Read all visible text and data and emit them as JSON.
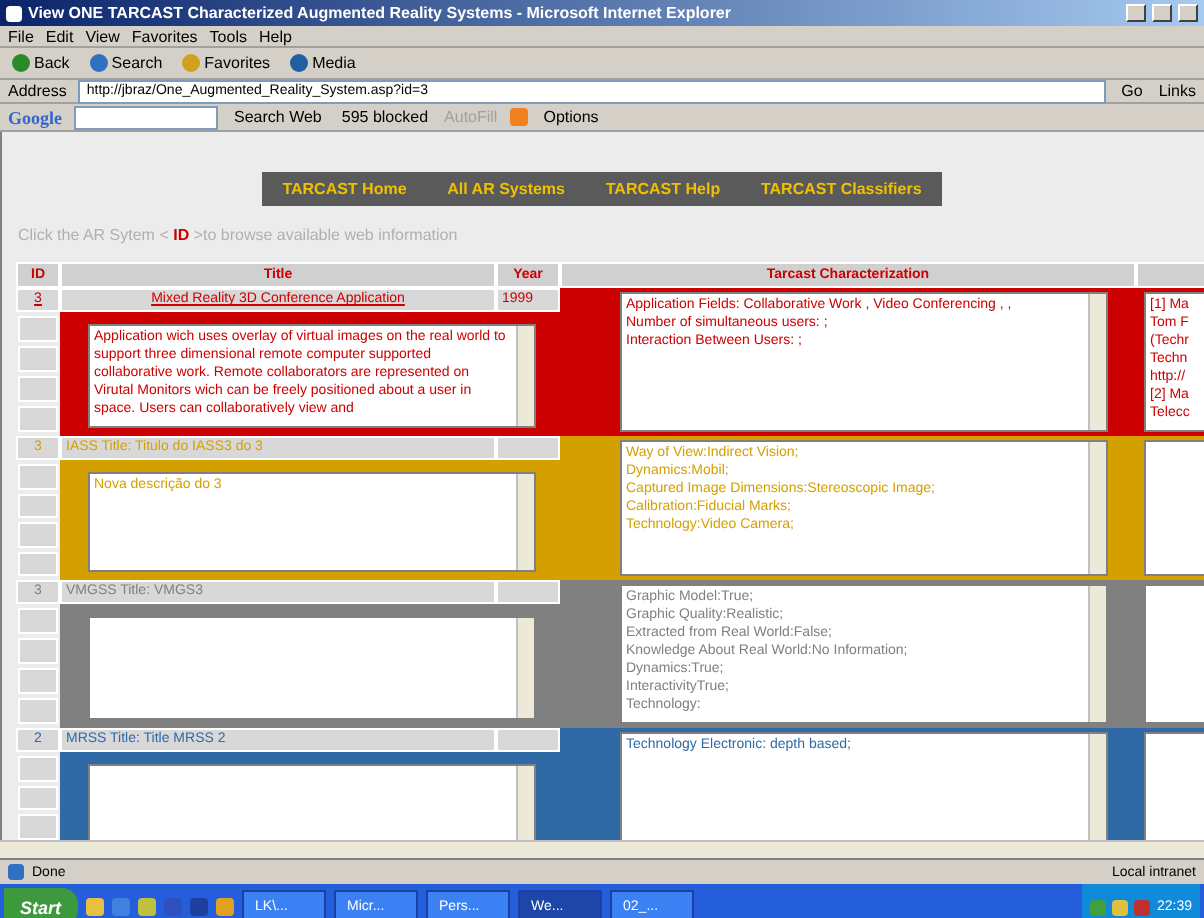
{
  "window": {
    "title": "View ONE TARCAST Characterized Augmented Reality Systems - Microsoft Internet Explorer"
  },
  "menu": [
    "File",
    "Edit",
    "View",
    "Favorites",
    "Tools",
    "Help"
  ],
  "toolbar": [
    "Back",
    "Search",
    "Favorites",
    "Media"
  ],
  "address": {
    "label": "Address",
    "value": "http://jbraz/One_Augmented_Reality_System.asp?id=3",
    "go": "Go",
    "links": "Links"
  },
  "google_bar": {
    "logo": "Google",
    "search": "Search Web",
    "blocked": "595 blocked",
    "autofill": "AutoFill",
    "options": "Options"
  },
  "nav": [
    "TARCAST Home",
    "All AR Systems",
    "TARCAST Help",
    "TARCAST Classifiers"
  ],
  "instruction": "Click the AR Sytem < **ID** >to browse available web information",
  "table": {
    "columns": [
      "ID",
      "Title",
      "Year",
      "Tarcast Characterization"
    ],
    "rows": [
      {
        "id": "3",
        "title": "Mixed Reality 3D Conference Application",
        "linked": true,
        "year": "1999",
        "color": "#cc0000",
        "description": "Application wich uses overlay of virtual images on the real world to support three dimensional remote computer supported collaborative work. Remote collaborators are represented on Virutal Monitors wich can be freely positioned about a user in space. Users can collaboratively view and",
        "characterization": [
          "Application Fields: Collaborative Work , Video Conferencing , ,",
          "Number of simultaneous users: ;",
          "Interaction Between Users: ;"
        ],
        "references": [
          "[1] Ma",
          "Tom F",
          "(Techr",
          "Techn",
          "http://",
          "[2] Ma",
          "Telecc"
        ]
      },
      {
        "id": "3",
        "title": "IASS Title: Titulo do IASS3 do 3",
        "linked": false,
        "color": "#d4a000",
        "description": "Nova descrição do 3",
        "characterization": [
          "Way of View:Indirect Vision;",
          "Dynamics:Mobil;",
          "Captured Image Dimensions:Stereoscopic Image;",
          "Calibration:Fiducial Marks;",
          "Technology:Video Camera;"
        ]
      },
      {
        "id": "3",
        "title": "VMGSS Title: VMGS3",
        "linked": false,
        "color": "#808080",
        "characterization": [
          "Graphic Model:True;",
          "Graphic Quality:Realistic;",
          "Extracted from Real World:False;",
          "Knowledge About Real World:No Information;",
          "Dynamics:True;",
          "InteractivityTrue;",
          "Technology:"
        ]
      },
      {
        "id": "2",
        "title": "MRSS Title: Title MRSS 2",
        "linked": false,
        "color": "#2f6aa6",
        "characterization": [
          "Technology Electronic: depth based;"
        ]
      }
    ]
  },
  "status_bar": {
    "text": "Done",
    "zone": "Local intranet"
  },
  "taskbar": {
    "start": "Start",
    "tasks": [
      {
        "label": "LK\\...",
        "selected": false
      },
      {
        "label": "Micr...",
        "selected": false
      },
      {
        "label": "Pers...",
        "selected": false
      },
      {
        "label": "We...",
        "selected": true
      },
      {
        "label": "02_...",
        "selected": false
      }
    ],
    "clock": "22:39"
  }
}
